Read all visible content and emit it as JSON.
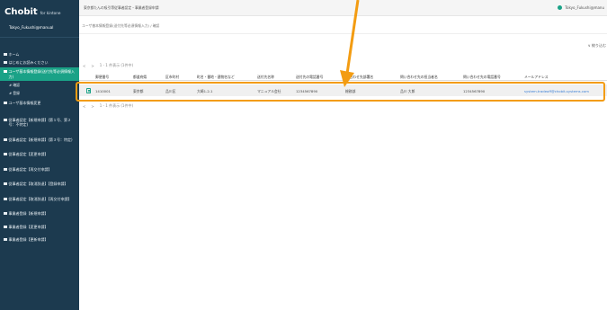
{
  "sidebar": {
    "logo_main": "Chobit",
    "logo_sub": "for kintone",
    "user": "Tokyo_Fukushi@manual",
    "menu": [
      {
        "label": "ホーム"
      },
      {
        "label": "はじめにお読みください"
      },
      {
        "label": "ユーザ基本情報登録(送付先等必須情報入力)",
        "active": true
      },
      {
        "label": "ユーザ基本情報変更"
      },
      {
        "label": "従事者認定【新規申請】(第１号、第２号：不特定)"
      },
      {
        "label": "従事者認定【新規申請】(第３号：特定)"
      },
      {
        "label": "従事者認定【変更申請】"
      },
      {
        "label": "従事者認定【再交付申請】"
      },
      {
        "label": "従事者認定【取消辞退】【登録申請】"
      },
      {
        "label": "従事者認定【取消辞退】【再交付申請】"
      },
      {
        "label": "事業者登録【新規申請】"
      },
      {
        "label": "事業者登録【変更申請】"
      },
      {
        "label": "事業者登録【更新申請】"
      }
    ],
    "submenu": [
      {
        "label": "# 確認"
      },
      {
        "label": "# 登録"
      }
    ]
  },
  "topbar": {
    "title": "東京都たんの吸引等従事者認定・事業者登録申請",
    "user": "Tokyo_Fukushi@manu"
  },
  "breadcrumb": "ユーザ基本情報登録(送付先等必須情報入力) / 確認",
  "more_button": "∨ 絞り込む",
  "pager": {
    "prev": "<",
    "next": ">",
    "text": "1 - 1 件表示 (1件中)"
  },
  "table": {
    "headers": [
      "郵便番号",
      "都道府県",
      "区市町村",
      "町名・番地・建物名など",
      "送付先名称",
      "送付先の電話番号",
      "問い合わせ先部署名",
      "問い合わせ先の担当者名",
      "問い合わせ先の電話番号",
      "メールアドレス"
    ],
    "row": {
      "postal": "1410001",
      "pref": "東京都",
      "city": "品川区",
      "address": "大崎1-2-1",
      "name": "マニュアル会社",
      "tel": "1234567890",
      "dept": "総務部",
      "person": "品川 大郎",
      "contact_tel": "1234567890",
      "email": "system.tradeoff@chobit-systems.com"
    }
  },
  "colors": {
    "sidebar_bg": "#1c3a4f",
    "active": "#1aa287",
    "highlight": "#f39c12",
    "link": "#3a7fd6"
  }
}
